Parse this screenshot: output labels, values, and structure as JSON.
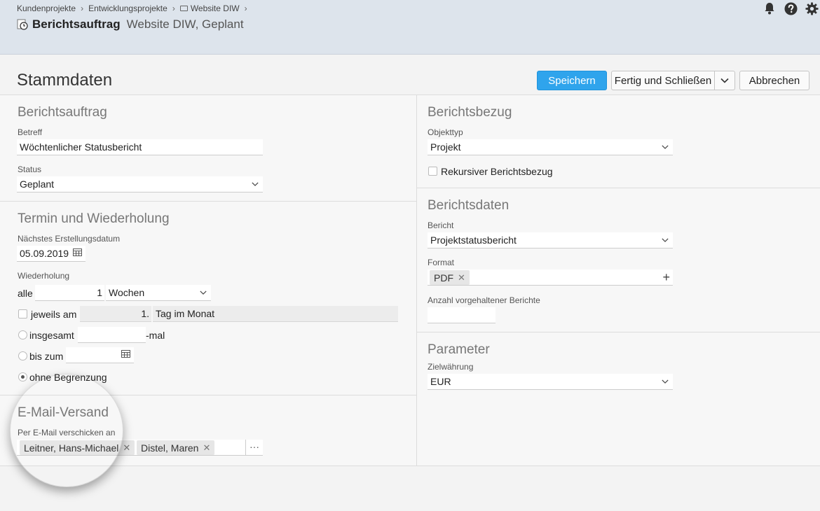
{
  "breadcrumb": {
    "items": [
      "Kundenprojekte",
      "Entwicklungsprojekte",
      "Website DIW"
    ],
    "separator": "›"
  },
  "header": {
    "title": "Berichtsauftrag",
    "subtitle": "Website DIW, Geplant",
    "icons": [
      "bell-icon",
      "help-icon",
      "gear-icon"
    ]
  },
  "page": {
    "title": "Stammdaten",
    "buttons": {
      "save": "Speichern",
      "done_close": "Fertig und Schließen",
      "cancel": "Abbrechen"
    }
  },
  "colors": {
    "primary": "#2fa4ec",
    "header_bg": "#dde4ec"
  },
  "left": {
    "berichtsauftrag": {
      "title": "Berichtsauftrag",
      "betreff_label": "Betreff",
      "betreff_value": "Wöchtenlicher Statusbericht",
      "status_label": "Status",
      "status_value": "Geplant"
    },
    "termin": {
      "title": "Termin und Wiederholung",
      "next_date_label": "Nächstes Erstellungsdatum",
      "next_date_value": "05.09.2019",
      "repeat_label": "Wiederholung",
      "alle_label": "alle",
      "alle_value": "1",
      "unit_value": "Wochen",
      "jeweils_label": "jeweils am",
      "jeweils_value": "1.",
      "jeweils_unit": "Tag im Monat",
      "insgesamt_label": "insgesamt",
      "mal_label": "-mal",
      "bis_label": "bis zum",
      "ohne_label": "ohne Begrenzung"
    },
    "email": {
      "title": "E-Mail-Versand",
      "recipients_label": "Per E-Mail verschicken an",
      "recipients": [
        "Leitner, Hans-Michael",
        "Distel, Maren"
      ],
      "more": "···"
    }
  },
  "right": {
    "bezug": {
      "title": "Berichtsbezug",
      "objekttyp_label": "Objekttyp",
      "objekttyp_value": "Projekt",
      "rekursiv_label": "Rekursiver Berichtsbezug"
    },
    "daten": {
      "title": "Berichtsdaten",
      "bericht_label": "Bericht",
      "bericht_value": "Projektstatusbericht",
      "format_label": "Format",
      "format_tag": "PDF",
      "anzahl_label": "Anzahl vorgehaltener Berichte"
    },
    "parameter": {
      "title": "Parameter",
      "waehrung_label": "Zielwährung",
      "waehrung_value": "EUR"
    }
  }
}
